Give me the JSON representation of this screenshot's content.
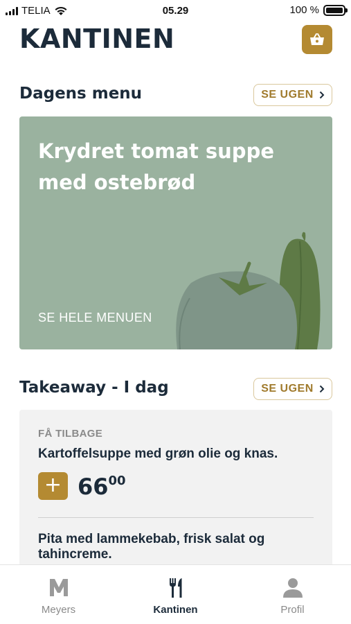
{
  "status_bar": {
    "carrier": "TELIA",
    "time": "05.29",
    "battery": "100 %",
    "battery_level": 1.0
  },
  "header": {
    "title": "KANTINEN",
    "cart_icon": "basket-icon"
  },
  "daily_menu": {
    "title": "Dagens menu",
    "see_week_label": "SE UGEN",
    "dish": "Krydret tomat suppe med ostebrød",
    "see_full_menu": "SE HELE MENUEN"
  },
  "takeaway": {
    "title": "Takeaway - I dag",
    "see_week_label": "SE UGEN",
    "items": [
      {
        "tag": "FÅ TILBAGE",
        "name": "Kartoffelsuppe med grøn olie og knas.",
        "add_label": "+",
        "price_main": "66",
        "price_decimals": "00"
      },
      {
        "name": "Pita med lammekebab, frisk salat og tahincreme."
      }
    ]
  },
  "tab_bar": {
    "tabs": [
      {
        "label": "Meyers",
        "icon": "meyers-m-icon"
      },
      {
        "label": "Kantinen",
        "icon": "fork-knife-icon",
        "active": true
      },
      {
        "label": "Profil",
        "icon": "person-icon"
      }
    ]
  },
  "colors": {
    "accent": "#b48a32",
    "navy": "#1c2b3a",
    "card_green": "#9ab29f",
    "card_gray": "#f2f2f2"
  }
}
